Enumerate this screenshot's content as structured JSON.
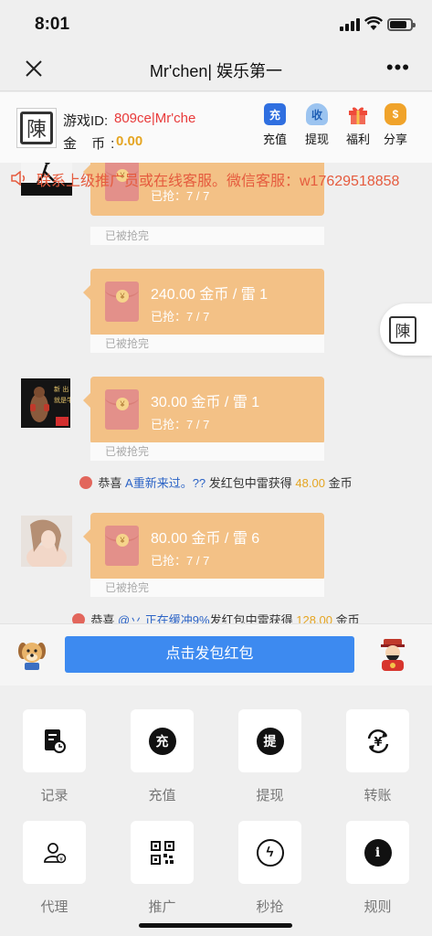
{
  "status": {
    "time": "8:01"
  },
  "nav": {
    "title": "Mr'chen| 娱乐第一"
  },
  "user": {
    "id_label": "游戏ID:",
    "id_value": "809ce|Mr'che",
    "coin_label": "金 币:",
    "coin_value": "0.00"
  },
  "top_actions": [
    {
      "label": "充值",
      "icon": "recharge-icon",
      "glyph": "充",
      "color": "#2f6fe0"
    },
    {
      "label": "提现",
      "icon": "withdraw-bag-icon",
      "glyph": "收",
      "color": "#6fa7e8"
    },
    {
      "label": "福利",
      "icon": "gift-icon",
      "glyph": "",
      "color": "#ef4b3a"
    },
    {
      "label": "分享",
      "icon": "coin-bag-icon",
      "glyph": "$",
      "color": "#f0a32a"
    }
  ],
  "marquee": {
    "text": "联系上级推广员或在线客服。微信客服：w17629518858"
  },
  "messages": [
    {
      "main": "",
      "sub": "已抢：7 / 7",
      "foot": "已被抢完"
    },
    {
      "main": "240.00 金币 / 雷 1",
      "sub": "已抢：7 / 7",
      "foot": "已被抢完"
    },
    {
      "main": "30.00 金币 / 雷 1",
      "sub": "已抢：7 / 7",
      "foot": "已被抢完"
    },
    {
      "main": "80.00 金币 / 雷 6",
      "sub": "已抢：7 / 7",
      "foot": "已被抢完"
    }
  ],
  "avatar_texts": {
    "boxer_line1": "新   出",
    "boxer_line2": "就是牛"
  },
  "notices": [
    {
      "prefix": "恭喜 ",
      "name": "A重新来过。??",
      "mid": " 发红包中雷获得 ",
      "amount": "48.00",
      "suffix": " 金币"
    },
    {
      "prefix": "恭喜 ",
      "name": "@丷 正在缓冲9%",
      "mid": "发红包中雷获得 ",
      "amount": "128.00",
      "suffix": " 金币"
    }
  ],
  "send_button": "点击发包红包",
  "grid": [
    {
      "label": "记录",
      "icon": "record-icon"
    },
    {
      "label": "充值",
      "icon": "recharge-circle-icon",
      "glyph": "充"
    },
    {
      "label": "提现",
      "icon": "withdraw-circle-icon",
      "glyph": "提"
    },
    {
      "label": "转账",
      "icon": "transfer-icon",
      "glyph": "¥"
    },
    {
      "label": "代理",
      "icon": "agent-icon"
    },
    {
      "label": "推广",
      "icon": "qrcode-icon"
    },
    {
      "label": "秒抢",
      "icon": "lightning-icon",
      "glyph": "ϟ"
    },
    {
      "label": "规则",
      "icon": "info-icon",
      "glyph": "i"
    }
  ]
}
